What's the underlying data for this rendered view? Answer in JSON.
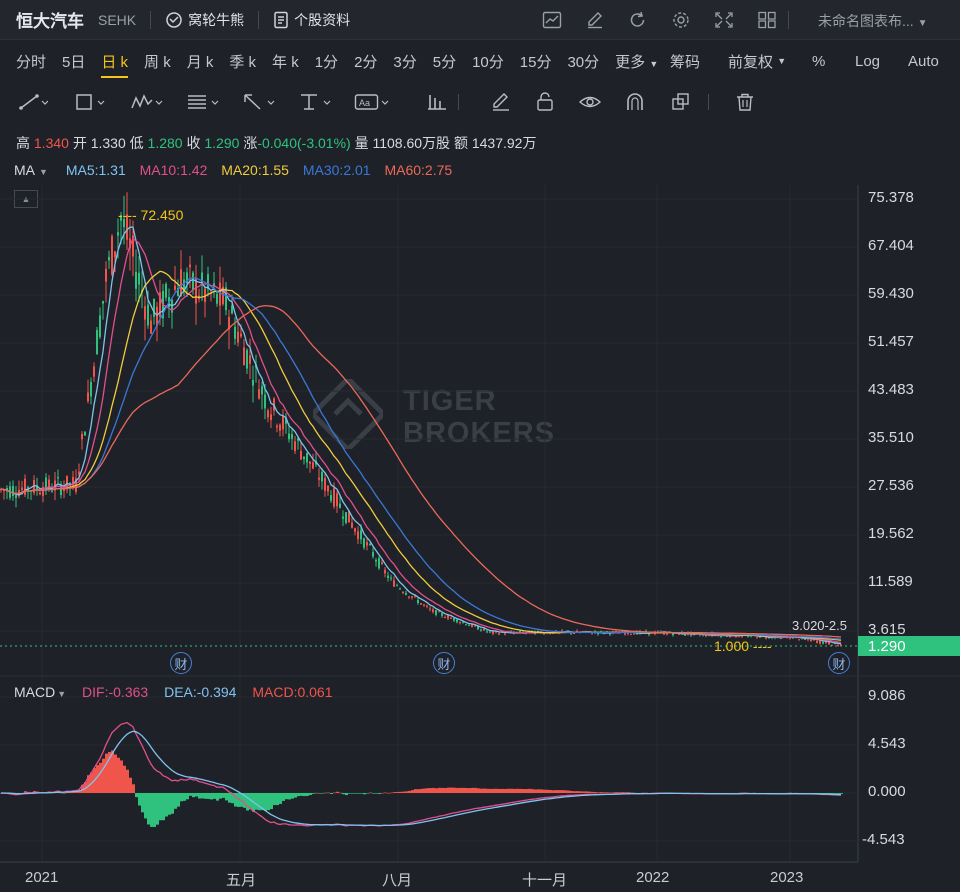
{
  "topbar": {
    "stock_name": "恒大汽车",
    "code": "SEHK",
    "warrants_label": "窝轮牛熊",
    "profile_label": "个股资料",
    "template_label": "未命名图表布..."
  },
  "periods": [
    "分时",
    "5日",
    "日 k",
    "周 k",
    "月 k",
    "季 k",
    "年 k",
    "1分",
    "2分",
    "3分",
    "5分",
    "10分",
    "15分",
    "30分",
    "更多"
  ],
  "active_period": "日 k",
  "options": {
    "chips": "筹码",
    "adjust": "前复权",
    "percent": "%",
    "log": "Log",
    "auto": "Auto"
  },
  "quote": {
    "high_label": "高",
    "high": "1.340",
    "open_label": "开",
    "open": "1.330",
    "low_label": "低",
    "low": "1.280",
    "close_label": "收",
    "close": "1.290",
    "change_label": "涨",
    "change": "-0.040(-3.01%)",
    "volume_label": "量",
    "volume": "1108.60万股",
    "amount_label": "额",
    "amount": "1437.92万"
  },
  "ma_legend": {
    "title": "MA",
    "ma5": "MA5:1.31",
    "ma10": "MA10:1.42",
    "ma20": "MA20:1.55",
    "ma30": "MA30:2.01",
    "ma60": "MA60:2.75"
  },
  "macd_legend": {
    "title": "MACD",
    "dif": "DIF:-0.363",
    "dea": "DEA:-0.394",
    "macd": "MACD:0.061"
  },
  "y_axis": [
    "75.378",
    "67.404",
    "59.430",
    "51.457",
    "43.483",
    "35.510",
    "27.536",
    "19.562",
    "11.589",
    "3.615"
  ],
  "macd_axis": [
    "9.086",
    "4.543",
    "0.000",
    "-4.543"
  ],
  "x_axis": [
    "2021",
    "五月",
    "八月",
    "十一月",
    "2022",
    "2023"
  ],
  "annotations": {
    "high_marker": "72.450",
    "low_marker": "1.000",
    "range_marker": "3.020-2.5",
    "last_price": "1.290",
    "fin_badge": "财"
  },
  "watermark": [
    "TIGER",
    "BROKERS"
  ],
  "colors": {
    "ma5": "#7fc3f0",
    "ma10": "#e0508e",
    "ma20": "#f0cc3e",
    "ma30": "#3a78d8",
    "ma60": "#ea6a5a",
    "up": "#f0554c",
    "down": "#2ec27e",
    "accent": "#f5c518"
  },
  "chart_data": {
    "type": "candlestick",
    "price_axis_ticks": [
      75.378,
      67.404,
      59.43,
      51.457,
      43.483,
      35.51,
      27.536,
      19.562,
      11.589,
      3.615
    ],
    "ma_series_names": [
      "MA5",
      "MA10",
      "MA20",
      "MA30",
      "MA60"
    ],
    "approx_close_path": [
      {
        "t": "2020-12",
        "close": 27
      },
      {
        "t": "2021-01",
        "close": 28
      },
      {
        "t": "2021-02",
        "close": 62
      },
      {
        "t": "2021-02-peak",
        "close": 72.45
      },
      {
        "t": "2021-03",
        "close": 55
      },
      {
        "t": "2021-04",
        "close": 62
      },
      {
        "t": "2021-05",
        "close": 58
      },
      {
        "t": "2021-06",
        "close": 42
      },
      {
        "t": "2021-07",
        "close": 29
      },
      {
        "t": "2021-08",
        "close": 12
      },
      {
        "t": "2021-09",
        "close": 7
      },
      {
        "t": "2021-10",
        "close": 3.3
      },
      {
        "t": "2021-11",
        "close": 3.4
      },
      {
        "t": "2022-01",
        "close": 3.3
      },
      {
        "t": "2022-12",
        "close": 2.6
      },
      {
        "t": "2023-02",
        "close": 1.29
      }
    ],
    "macd_axis_ticks": [
      9.086,
      4.543,
      0.0,
      -4.543
    ]
  }
}
